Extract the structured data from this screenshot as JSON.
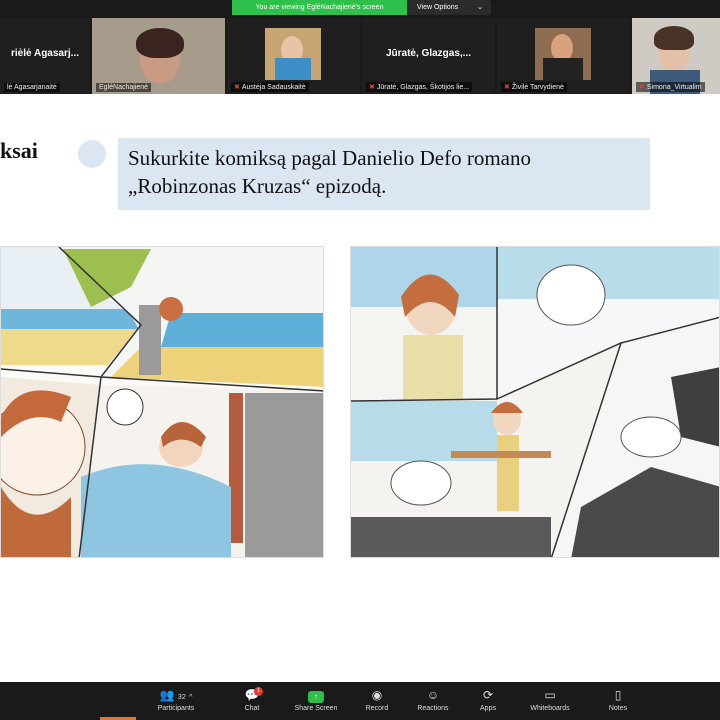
{
  "banner": {
    "viewing_text": "You are viewing EgléNachajiené's screen",
    "view_options": "View Options"
  },
  "participants": [
    {
      "tile_title": "riėlė Agasarj...",
      "name": "lė Agasarjanaitė",
      "muted": false,
      "video": false
    },
    {
      "tile_title": "",
      "name": "EgléNachajiené",
      "muted": false,
      "video": true
    },
    {
      "tile_title": "",
      "name": "Austėja Sadauskaitė",
      "muted": true,
      "video": true
    },
    {
      "tile_title": "Jūratė, Glazgas,...",
      "name": "Jūratė, Glazgas, Škotijos lie...",
      "muted": true,
      "video": false
    },
    {
      "tile_title": "",
      "name": "Živilė Tarvydienė",
      "muted": true,
      "video": true
    },
    {
      "tile_title": "",
      "name": "Simona_Virtualim",
      "muted": true,
      "video": true
    }
  ],
  "slide": {
    "title": "ksai",
    "task_text": "Sukurkite komiksą pagal Danielio Defo romano „Robinzonas Kruzas“ epizodą."
  },
  "toolbar": {
    "participants_label": "Participants",
    "participants_count": "32",
    "chat_label": "Chat",
    "chat_badge": "1",
    "share_label": "Share Screen",
    "record_label": "Record",
    "reactions_label": "Reactions",
    "apps_label": "Apps",
    "whiteboards_label": "Whiteboards",
    "notes_label": "Notes"
  },
  "icons": {
    "participants": "people-icon",
    "chat": "chat-bubble-icon",
    "share": "share-screen-icon",
    "record": "record-icon",
    "reactions": "smile-icon",
    "apps": "apps-icon",
    "whiteboards": "whiteboard-icon",
    "notes": "notes-icon"
  },
  "colors": {
    "banner_green": "#2fbf4b",
    "muted_red": "#e53935",
    "task_box_blue": "#dce6f2"
  }
}
